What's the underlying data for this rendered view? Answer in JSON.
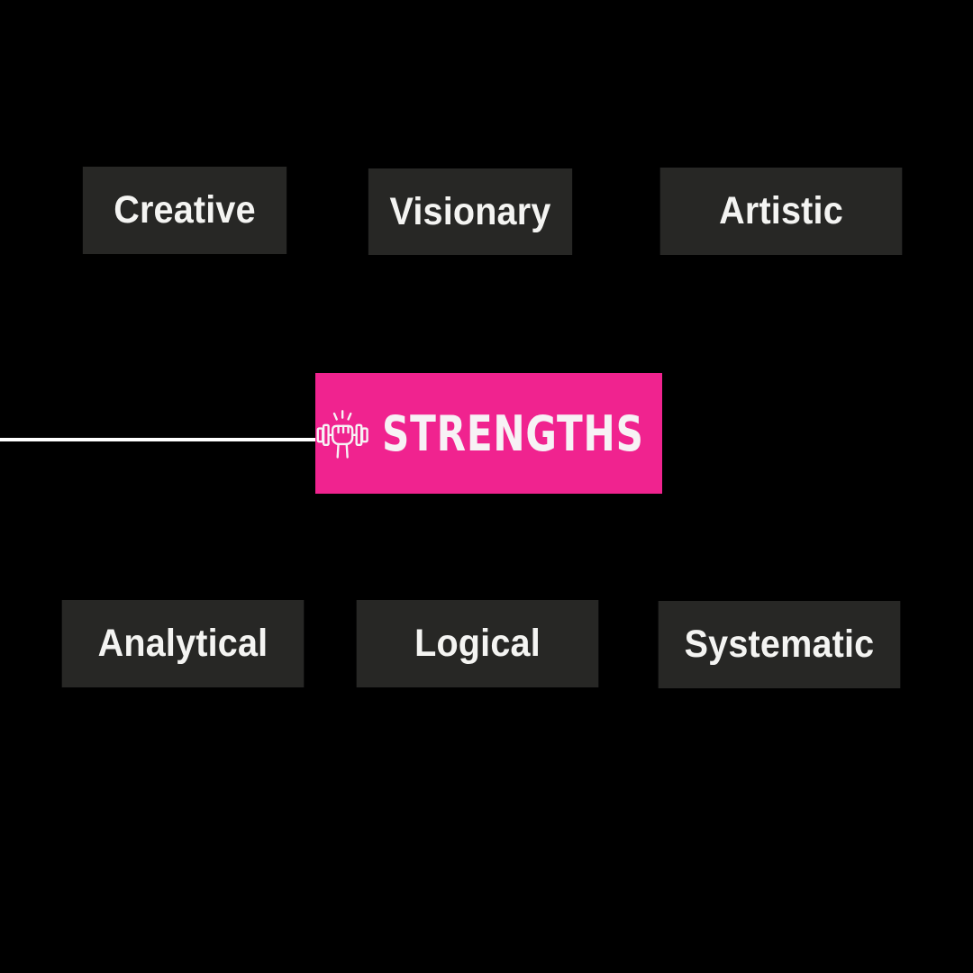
{
  "center": {
    "label": "STRENGTHS",
    "icon": "fist-dumbbell-icon",
    "color": "#f0238f"
  },
  "top_row": [
    {
      "label": "Creative"
    },
    {
      "label": "Visionary"
    },
    {
      "label": "Artistic"
    }
  ],
  "bottom_row": [
    {
      "label": "Analytical"
    },
    {
      "label": "Logical"
    },
    {
      "label": "Systematic"
    }
  ],
  "colors": {
    "background": "#000000",
    "tag_background": "#272725",
    "tag_text": "#f4f4f2",
    "connector": "#ffffff"
  }
}
